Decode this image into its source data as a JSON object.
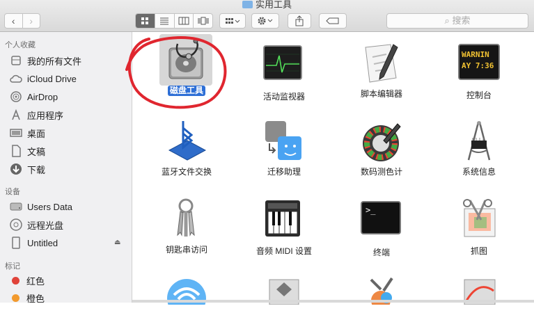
{
  "window": {
    "title": "实用工具"
  },
  "toolbar": {
    "back_icon": "‹",
    "forward_icon": "›",
    "search_placeholder": "搜索",
    "search_icon": "⌕"
  },
  "sidebar": {
    "favorites_header": "个人收藏",
    "favorites": [
      {
        "label": "我的所有文件",
        "icon": "all-files-icon"
      },
      {
        "label": "iCloud Drive",
        "icon": "cloud-icon"
      },
      {
        "label": "AirDrop",
        "icon": "airdrop-icon"
      },
      {
        "label": "应用程序",
        "icon": "applications-icon"
      },
      {
        "label": "桌面",
        "icon": "desktop-icon"
      },
      {
        "label": "文稿",
        "icon": "documents-icon"
      },
      {
        "label": "下载",
        "icon": "downloads-icon"
      }
    ],
    "devices_header": "设备",
    "devices": [
      {
        "label": "Users Data",
        "icon": "disk-icon"
      },
      {
        "label": "远程光盘",
        "icon": "remote-disc-icon"
      },
      {
        "label": "Untitled",
        "icon": "disk-icon"
      }
    ],
    "tags_header": "标记",
    "tags": [
      {
        "label": "红色",
        "color": "#e0433a"
      },
      {
        "label": "橙色",
        "color": "#f29a2e"
      }
    ]
  },
  "apps": [
    {
      "label": "磁盘工具",
      "selected": true
    },
    {
      "label": "活动监视器"
    },
    {
      "label": "脚本编辑器"
    },
    {
      "label": "控制台"
    },
    {
      "label": "蓝牙文件交换"
    },
    {
      "label": "迁移助理"
    },
    {
      "label": "数码测色计"
    },
    {
      "label": "系统信息"
    },
    {
      "label": "钥匙串访问"
    },
    {
      "label": "音频 MIDI 设置"
    },
    {
      "label": "终端"
    },
    {
      "label": "抓图"
    }
  ],
  "console_text": [
    "WARNIN",
    "AY 7:36"
  ],
  "terminal_text": ">_",
  "annotation_color": "#e0262f"
}
